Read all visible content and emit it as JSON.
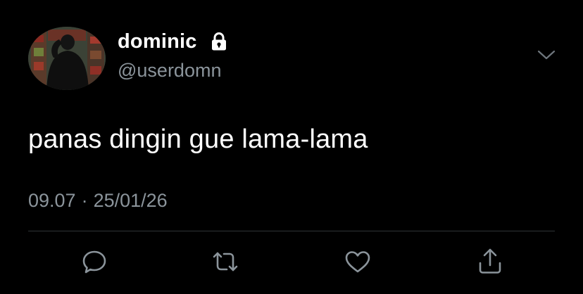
{
  "user": {
    "display_name": "dominic",
    "handle": "@userdomn",
    "protected": true,
    "avatar": "profile-photo"
  },
  "tweet": {
    "text": "panas dingin gue lama-lama",
    "time": "09.07",
    "separator": "·",
    "date": "25/01/26"
  },
  "actions": [
    {
      "name": "reply",
      "icon": "speech-bubble-icon"
    },
    {
      "name": "retweet",
      "icon": "retweet-arrows-icon"
    },
    {
      "name": "like",
      "icon": "heart-icon"
    },
    {
      "name": "share",
      "icon": "share-arrow-icon"
    }
  ],
  "icons": {
    "menu": "chevron-down-icon",
    "protected": "lock-icon"
  },
  "colors": {
    "background": "#000000",
    "text_primary": "#ffffff",
    "text_secondary": "#8b949b",
    "divider": "#2f3336"
  }
}
